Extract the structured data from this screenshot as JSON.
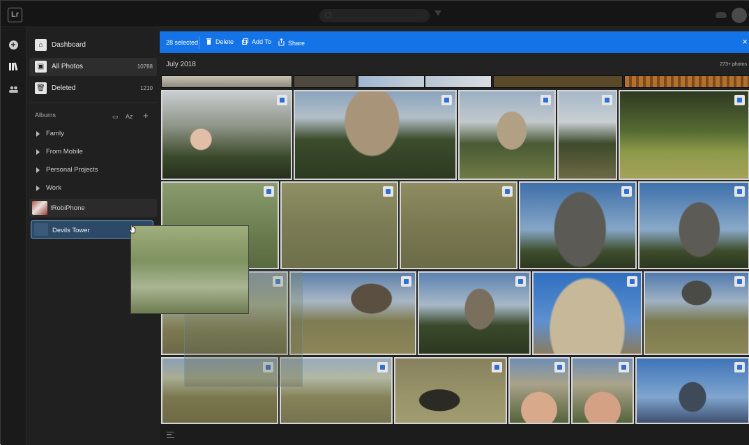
{
  "app": {
    "logo": "Lr"
  },
  "rail": {
    "icons": [
      "add-icon",
      "library-icon",
      "people-icon"
    ]
  },
  "sidebar": {
    "nav": [
      {
        "label": "Dashboard",
        "count": "",
        "icon": "home-icon"
      },
      {
        "label": "All Photos",
        "count": "10788",
        "icon": "photos-icon"
      },
      {
        "label": "Deleted",
        "count": "1210",
        "icon": "trash-icon"
      }
    ],
    "albums_header": "Albums",
    "albums_sort": "Az",
    "albums": [
      {
        "label": "Famly"
      },
      {
        "label": "From Mobile"
      },
      {
        "label": "Personal Projects"
      },
      {
        "label": "Work"
      },
      {
        "label": "!RobiPhone"
      },
      {
        "label": "Devils Tower"
      }
    ]
  },
  "selection_bar": {
    "count": "28 selected",
    "delete": "Delete",
    "add_to": "Add To",
    "share": "Share",
    "close": "×"
  },
  "content": {
    "date_group": "July 2018",
    "photo_count": "273+ photos"
  },
  "colors": {
    "accent": "#1473e6",
    "selected_album": "#2c4a68"
  }
}
